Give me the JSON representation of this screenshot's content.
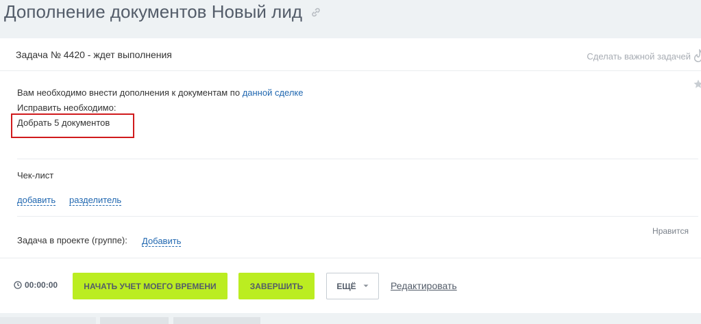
{
  "page": {
    "title": "Дополнение документов Новый лид"
  },
  "task": {
    "header": "Задача № 4420 - ждет выполнения",
    "make_important": "Сделать важной задачей",
    "description": {
      "line1_prefix": "Вам необходимо внести дополнения к документам по ",
      "line1_link": "данной сделке",
      "line2": "Исправить необходимо:",
      "line3": "Добрать 5 документов"
    },
    "checklist": {
      "title": "Чек-лист",
      "add": "добавить",
      "separator": "разделитель"
    },
    "likes": "Нравится",
    "project": {
      "label": "Задача в проекте (группе):",
      "add": "Добавить"
    }
  },
  "footer": {
    "timer": "00:00:00",
    "start_tracking": "НАЧАТЬ УЧЕТ МОЕГО ВРЕМЕНИ",
    "complete": "ЗАВЕРШИТЬ",
    "more": "ЕЩЁ",
    "edit": "Редактировать"
  },
  "colors": {
    "accent_green": "#bbed21",
    "link_blue": "#2067b0",
    "highlight_red": "#d0191b"
  }
}
